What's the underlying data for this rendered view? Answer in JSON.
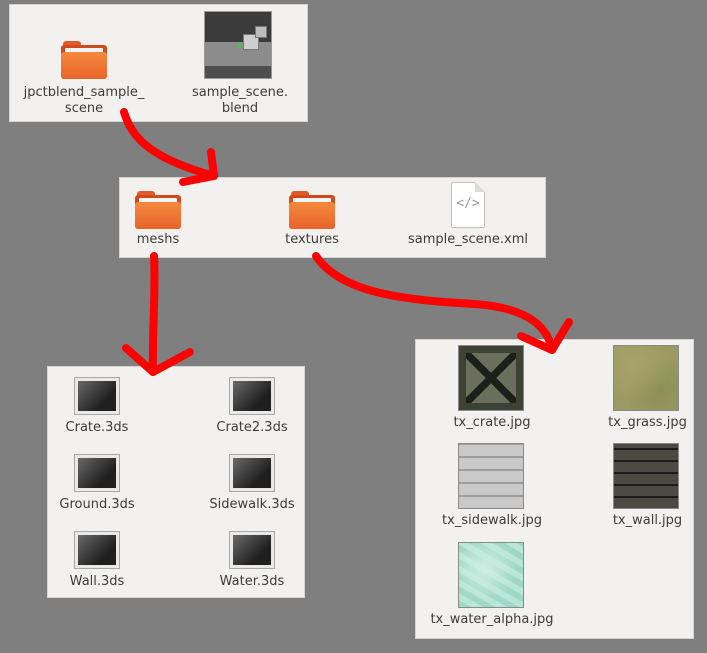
{
  "panels": {
    "root": {
      "items": [
        {
          "label_line1": "jpctblend_sample_",
          "label_line2": "scene",
          "type": "folder",
          "icon": "folder-icon"
        },
        {
          "label_line1": "sample_scene.",
          "label_line2": "blend",
          "type": "blend",
          "icon": "blend-thumbnail"
        }
      ]
    },
    "scene": {
      "items": [
        {
          "label": "meshs",
          "type": "folder",
          "icon": "folder-icon"
        },
        {
          "label": "textures",
          "type": "folder",
          "icon": "folder-icon"
        },
        {
          "label": "sample_scene.xml",
          "type": "xml",
          "icon": "xml-document-icon",
          "glyph": "</>"
        }
      ]
    },
    "meshs": {
      "items": [
        {
          "label": "Crate.3ds"
        },
        {
          "label": "Crate2.3ds"
        },
        {
          "label": "Ground.3ds"
        },
        {
          "label": "Sidewalk.3ds"
        },
        {
          "label": "Wall.3ds"
        },
        {
          "label": "Water.3ds"
        }
      ]
    },
    "textures": {
      "items": [
        {
          "label": "tx_crate.jpg"
        },
        {
          "label": "tx_grass.jpg"
        },
        {
          "label": "tx_sidewalk.jpg"
        },
        {
          "label": "tx_wall.jpg"
        },
        {
          "label": "tx_water_alpha.jpg"
        }
      ]
    }
  },
  "colors": {
    "background": "#7f7f7f",
    "panel": "#f2f1f0",
    "folder_orange": "#e9642a",
    "annotation_red": "#ff0000"
  }
}
